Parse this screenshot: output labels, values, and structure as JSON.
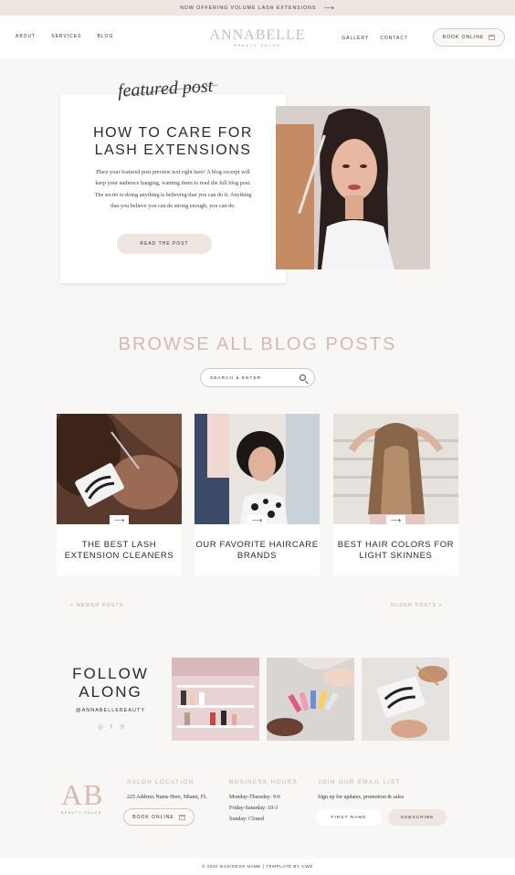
{
  "announcement": {
    "text": "NOW OFFERING VOLUME LASH EXTENSIONS",
    "arrow": "⟶"
  },
  "header": {
    "nav_left": [
      "ABOUT",
      "SERVICES",
      "BLOG"
    ],
    "logo_name": "ANNABELLE",
    "logo_sub": "BEAUTY SALON",
    "nav_right": [
      "GALLERY",
      "CONTACT"
    ],
    "book_label": "BOOK ONLINE"
  },
  "featured": {
    "script_label": "featured post",
    "title_line1": "HOW TO CARE FOR",
    "title_line2": "LASH EXTENSIONS",
    "excerpt": "Place your featured post preview text right here! A blog excerpt will keep your audience hanging, wanting them to read the full blog post. The secret to doing anything is believing that you can do it. Anything that you believe you can do strong enough, you can do.",
    "button": "READ THE POST"
  },
  "browse": {
    "title": "BROWSE ALL BLOG POSTS",
    "search_placeholder": "SEARCH & ENTER"
  },
  "posts": [
    {
      "title": "THE BEST LASH EXTENSION CLEANERS",
      "arrow": "⟶"
    },
    {
      "title": "OUR FAVORITE HAIRCARE BRANDS",
      "arrow": "⟶"
    },
    {
      "title": "BEST HAIR COLORS FOR LIGHT SKINNES",
      "arrow": "⟶"
    }
  ],
  "pager": {
    "newer": "< NEWER POSTS",
    "older": "OLDER POSTS >"
  },
  "follow": {
    "line1": "FOLLOW",
    "line2": "ALONG",
    "handle": "@ANNABELLEBEAUTY",
    "icons": [
      "instagram-icon",
      "facebook-icon",
      "pinterest-icon"
    ]
  },
  "footer": {
    "logo": "AB",
    "logo_sub": "BEAUTY SALON",
    "location_head": "SALON LOCATION",
    "address": "225 Address Name Here, Miami, FL",
    "book_label": "BOOK ONLINE",
    "hours_head": "BUSINESS HOURS",
    "hours": [
      "Monday-Thursday: 9-6",
      "Friday-Saturday: 10-3",
      "Sunday: Closed"
    ],
    "email_head": "JOIN OUR EMAIL LIST",
    "email_text": "Sign up for updates, promotion & sales",
    "first_name_placeholder": "FIRST NAME",
    "subscribe": "SUBSCRIBE",
    "copyright": "© 2020 BUSINESS NAME | TEMPLATE BY CWD"
  },
  "colors": {
    "accent": "#d4b9b3",
    "soft_pink": "#efe6e2",
    "background": "#f8f7f6"
  }
}
